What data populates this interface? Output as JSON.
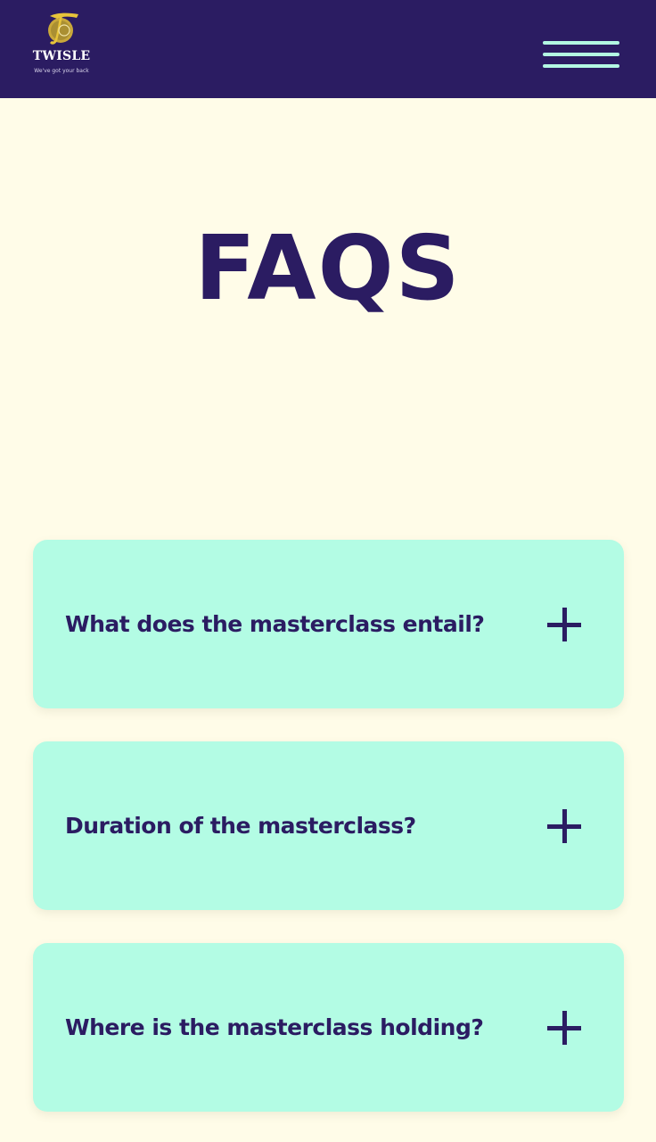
{
  "header": {
    "logo": {
      "name": "TWISLE",
      "tagline": "We've got your back",
      "icon": "twisle-logo-emblem",
      "color_gold": "#e7c43a"
    },
    "menu_icon": "hamburger-menu-icon"
  },
  "main": {
    "title": "FAQS",
    "faqs": [
      {
        "question": "What does the masterclass entail?",
        "icon": "plus-icon"
      },
      {
        "question": "Duration of the masterclass?",
        "icon": "plus-icon"
      },
      {
        "question": "Where is the masterclass holding?",
        "icon": "plus-icon"
      }
    ]
  },
  "colors": {
    "header_bg": "#2b1c62",
    "page_bg": "#fffce8",
    "card_bg": "#b3fce4",
    "accent_mint": "#b3f8e3",
    "text_primary": "#2b1c62"
  }
}
